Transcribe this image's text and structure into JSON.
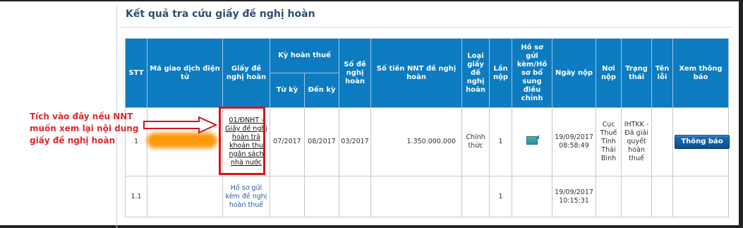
{
  "page": {
    "title": "Kết quả tra cứu giấy đề nghị hoàn"
  },
  "annotation": {
    "text": "Tích vào đây nếu NNT muốn xem lại nội dung giấy đề nghị hoàn"
  },
  "table": {
    "headers": {
      "stt": "STT",
      "ma_giao_dich": "Mã giao dịch điện tử",
      "giay_de_nghi": "Giấy đề nghị hoàn",
      "ky_hoan_thue": "Kỳ hoàn thuế",
      "tu_ky": "Từ kỳ",
      "den_ky": "Đến kỳ",
      "so_de_nghi": "Số đề nghị hoàn",
      "so_tien": "Số tiền NNT đề nghị hoàn",
      "loai_giay": "Loại giấy đề nghị hoàn",
      "lan_nop": "Lần nộp",
      "ho_so": "Hồ sơ gửi kèm/Hồ sơ bổ sung điều chỉnh",
      "ngay_nop": "Ngày nộp",
      "noi_nop": "Nơi nộp",
      "trang_thai": "Trạng thái",
      "ten_loi": "Tên lỗi",
      "xem_thong_bao": "Xem thông báo"
    },
    "rows": [
      {
        "stt": "1",
        "giay_de_nghi": "01/ĐNHT - Giấy đề nghị hoàn trả khoản thu ngân sách nhà nước",
        "tu_ky": "07/2017",
        "den_ky": "08/2017",
        "so_de_nghi": "03/2017",
        "so_tien": "1.350.000.000",
        "loai_giay": "Chính thức",
        "lan_nop": "1",
        "ho_so_icon": "attachment-icon",
        "ngay_nop": "19/09/2017 08:58:49",
        "noi_nop": "Cục Thuế Tỉnh Thái Bình",
        "trang_thai": "IHTKK - Đã giải quyết hoàn thuế",
        "button_label": "Thông báo"
      },
      {
        "stt": "1.1",
        "giay_de_nghi": "Hồ sơ gửi kèm đề nghị hoàn thuế",
        "lan_nop": "1",
        "ngay_nop": "19/09/2017 10:15:31"
      }
    ]
  }
}
